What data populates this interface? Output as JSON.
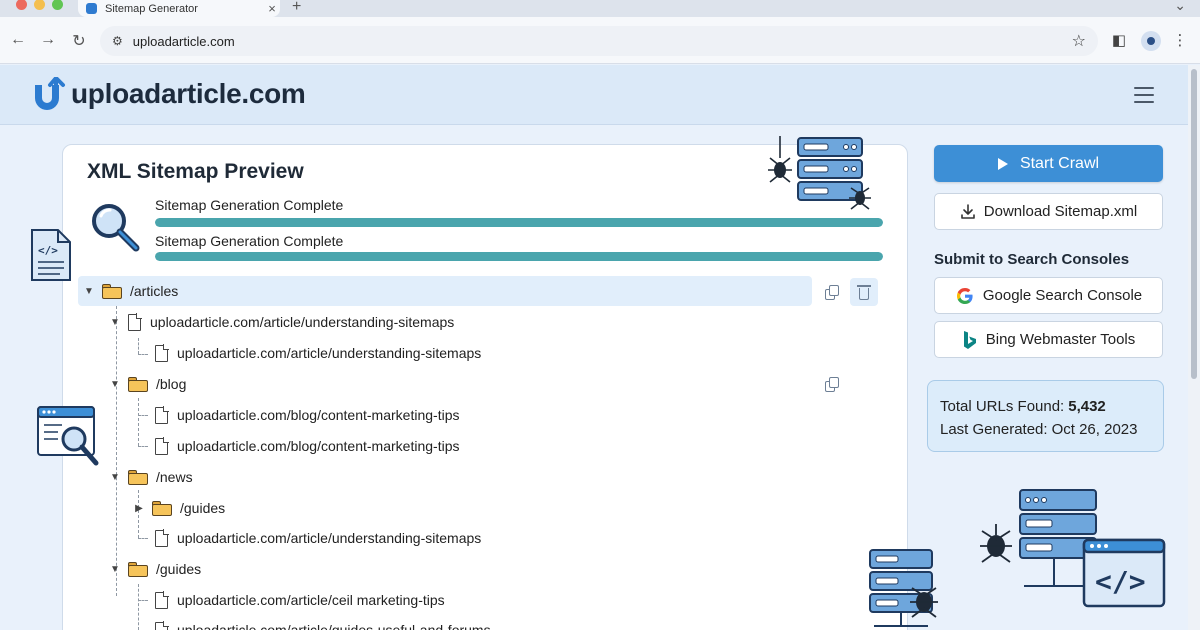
{
  "browser": {
    "tab_title": "Sitemap Generator",
    "tab_close": "×",
    "new_tab": "+",
    "url": "uploadarticle.com"
  },
  "site": {
    "logo_text": "uploadarticle.com"
  },
  "preview": {
    "title": "XML Sitemap Preview",
    "progress": [
      {
        "label": "Sitemap Generation Complete",
        "fraction": 1.0
      },
      {
        "label": "Sitemap Generation Complete",
        "fraction": 1.0
      }
    ],
    "tree": [
      {
        "type": "folder",
        "label": "/articles"
      },
      {
        "type": "file",
        "label": "uploadarticle.com/article/understanding-sitemaps"
      },
      {
        "type": "file",
        "label": "uploadarticle.com/article/understanding-sitemaps"
      },
      {
        "type": "folder",
        "label": "/blog"
      },
      {
        "type": "file",
        "label": "uploadarticle.com/blog/content-marketing-tips"
      },
      {
        "type": "file",
        "label": "uploadarticle.com/blog/content-marketing-tips"
      },
      {
        "type": "folder",
        "label": "/news"
      },
      {
        "type": "folder",
        "label": "/guides"
      },
      {
        "type": "file",
        "label": "uploadarticle.com/article/understanding-sitemaps"
      },
      {
        "type": "folder",
        "label": "/guides"
      },
      {
        "type": "file",
        "label": "uploadarticle.com/article/ceil marketing-tips"
      },
      {
        "type": "file",
        "label": "uploadarticle.com/article/guides-useful-and-forums"
      }
    ]
  },
  "actions": {
    "start_crawl": "Start Crawl",
    "download": "Download Sitemap.xml",
    "consoles_title": "Submit to Search Consoles",
    "google": "Google Search Console",
    "bing": "Bing Webmaster Tools"
  },
  "stats": {
    "urls_label": "Total URLs Found:",
    "urls_value": "5,432",
    "generated_label": "Last Generated:",
    "generated_value": "Oct 26, 2023"
  },
  "colors": {
    "accent": "#3d8fd6",
    "progress": "#4aa5ad",
    "folder": "#f6c45a"
  }
}
